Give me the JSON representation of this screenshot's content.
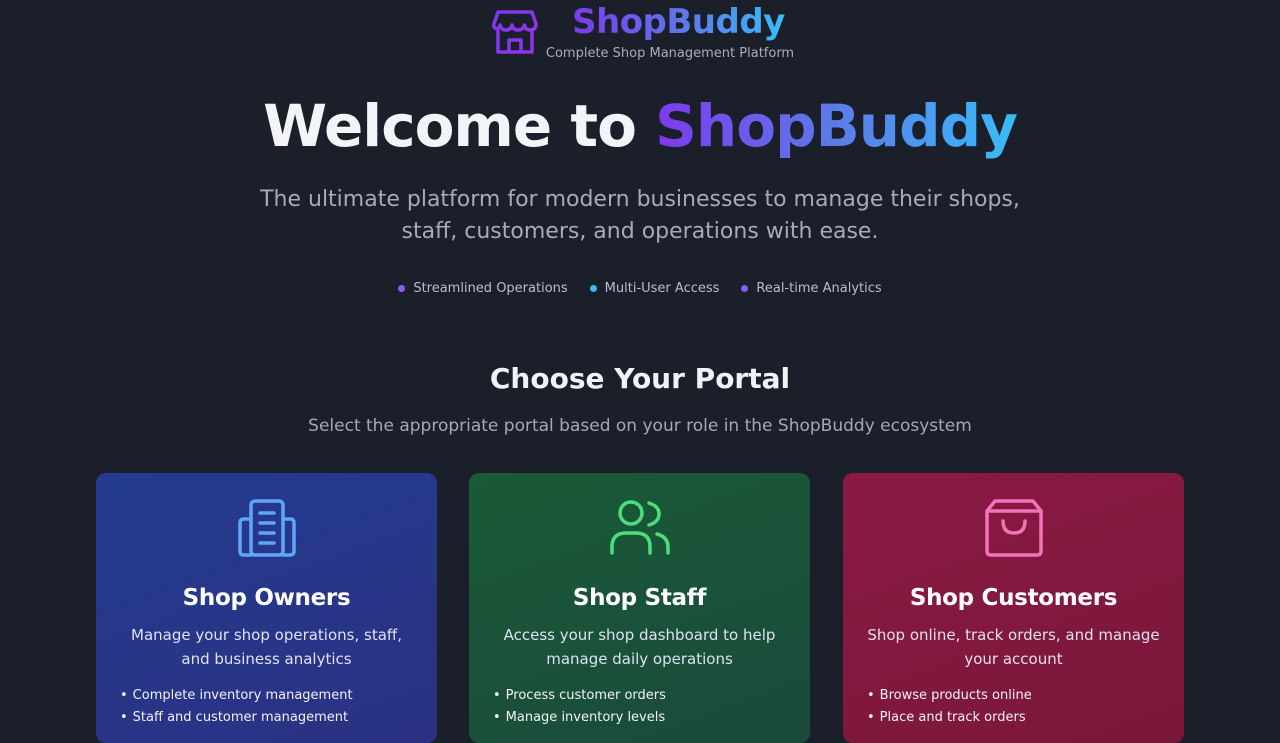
{
  "brand": {
    "name": "ShopBuddy",
    "tagline": "Complete Shop Management Platform",
    "logo_icon": "storefront-icon"
  },
  "hero": {
    "title_prefix": "Welcome to ",
    "title_brand": "ShopBuddy",
    "subtitle": "The ultimate platform for modern businesses to manage their shops, staff, customers, and operations with ease.",
    "features": [
      {
        "label": "Streamlined Operations",
        "dot_color": "#8b5cf6"
      },
      {
        "label": "Multi-User Access",
        "dot_color": "#38bdf8"
      },
      {
        "label": "Real-time Analytics",
        "dot_color": "#8b5cf6"
      }
    ]
  },
  "portal": {
    "title": "Choose Your Portal",
    "subtitle": "Select the appropriate portal based on your role in the ShopBuddy ecosystem"
  },
  "cards": [
    {
      "title": "Shop Owners",
      "description": "Manage your shop operations, staff, and business analytics",
      "icon": "building-icon",
      "icon_color": "#60a5fa",
      "items": [
        "Complete inventory management",
        "Staff and customer management"
      ]
    },
    {
      "title": "Shop Staff",
      "description": "Access your shop dashboard to help manage daily operations",
      "icon": "users-icon",
      "icon_color": "#4ade80",
      "items": [
        "Process customer orders",
        "Manage inventory levels"
      ]
    },
    {
      "title": "Shop Customers",
      "description": "Shop online, track orders, and manage your account",
      "icon": "shopping-bag-icon",
      "icon_color": "#f472b6",
      "items": [
        "Browse products online",
        "Place and track orders"
      ]
    }
  ],
  "colors": {
    "background": "#1b1f2a",
    "gradient_start": "#7c3aed",
    "gradient_end": "#38bdf8"
  }
}
